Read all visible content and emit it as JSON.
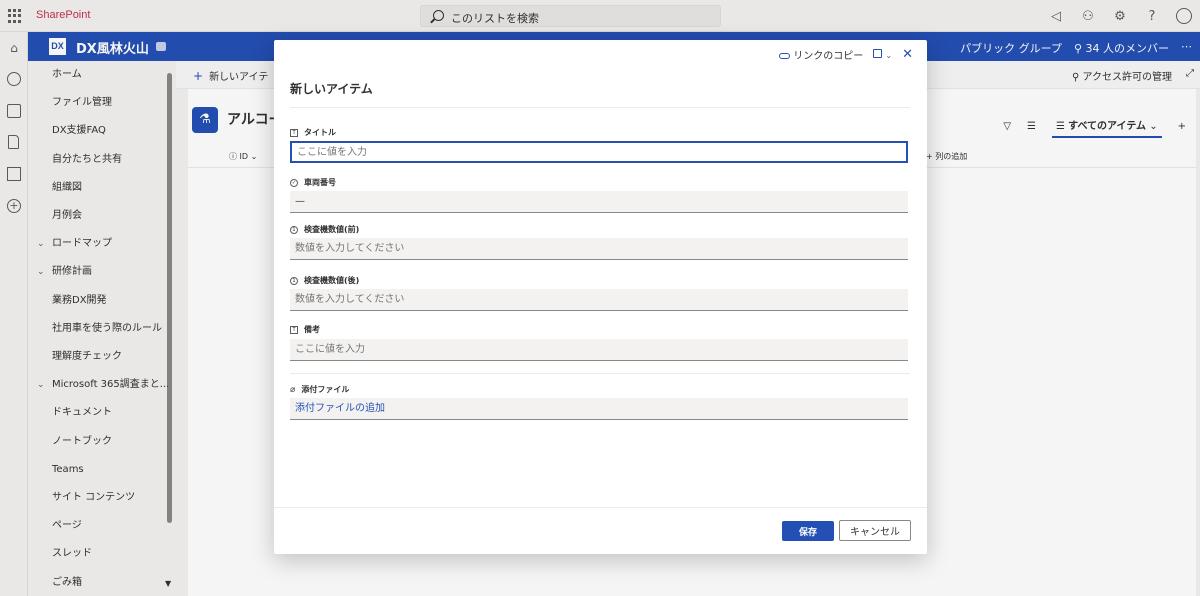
{
  "suite": {
    "brand": "SharePoint",
    "search_placeholder": "このリストを検索",
    "icons": [
      "megaphone-icon",
      "share-icon",
      "settings-icon",
      "help-icon",
      "profile-icon"
    ],
    "help_glyph": "?"
  },
  "site": {
    "logo": "DX",
    "title": "DX風林火山",
    "group_label": "パブリック グループ",
    "members_label": "34 人のメンバー",
    "expand_glyph": "⋯"
  },
  "nav": {
    "items": [
      {
        "label": "ホーム",
        "chevron": false
      },
      {
        "label": "ファイル管理",
        "chevron": false
      },
      {
        "label": "DX支援FAQ",
        "chevron": false
      },
      {
        "label": "自分たちと共有",
        "chevron": false
      },
      {
        "label": "組織図",
        "chevron": false
      },
      {
        "label": "月例会",
        "chevron": false
      },
      {
        "label": "ロードマップ",
        "chevron": true
      },
      {
        "label": "研修計画",
        "chevron": true
      },
      {
        "label": "業務DX開発",
        "chevron": false
      },
      {
        "label": "社用車を使う際のルール",
        "chevron": false
      },
      {
        "label": "理解度チェック",
        "chevron": false
      },
      {
        "label": "Microsoft 365調査まと...",
        "chevron": true
      },
      {
        "label": "ドキュメント",
        "chevron": false
      },
      {
        "label": "ノートブック",
        "chevron": false
      },
      {
        "label": "Teams",
        "chevron": false
      },
      {
        "label": "サイト コンテンツ",
        "chevron": false
      },
      {
        "label": "ページ",
        "chevron": false
      },
      {
        "label": "スレッド",
        "chevron": false
      },
      {
        "label": "ごみ箱",
        "chevron": false
      }
    ]
  },
  "commandbar": {
    "new_label": "新しいアイテ",
    "access_label": "アクセス許可の管理"
  },
  "list": {
    "title": "アルコー",
    "view_label": "すべてのアイテム",
    "col_id": "ID",
    "col_add": "列の追加"
  },
  "dialog": {
    "copy_link": "リンクのコピー",
    "title": "新しいアイテム",
    "fields": {
      "title": {
        "label": "タイトル",
        "placeholder": "ここに値を入力"
      },
      "vehicle": {
        "label": "車両番号",
        "value": "—"
      },
      "before": {
        "label": "検査機数値(前)",
        "placeholder": "数値を入力してください"
      },
      "after": {
        "label": "検査機数値(後)",
        "placeholder": "数値を入力してください"
      },
      "note": {
        "label": "備考",
        "placeholder": "ここに値を入力"
      },
      "attach": {
        "label": "添付ファイル",
        "action": "添付ファイルの追加"
      }
    },
    "save": "保存",
    "cancel": "キャンセル"
  },
  "colors": {
    "brand_blue": "#2450b6",
    "sharepoint_red": "#c4314b"
  }
}
